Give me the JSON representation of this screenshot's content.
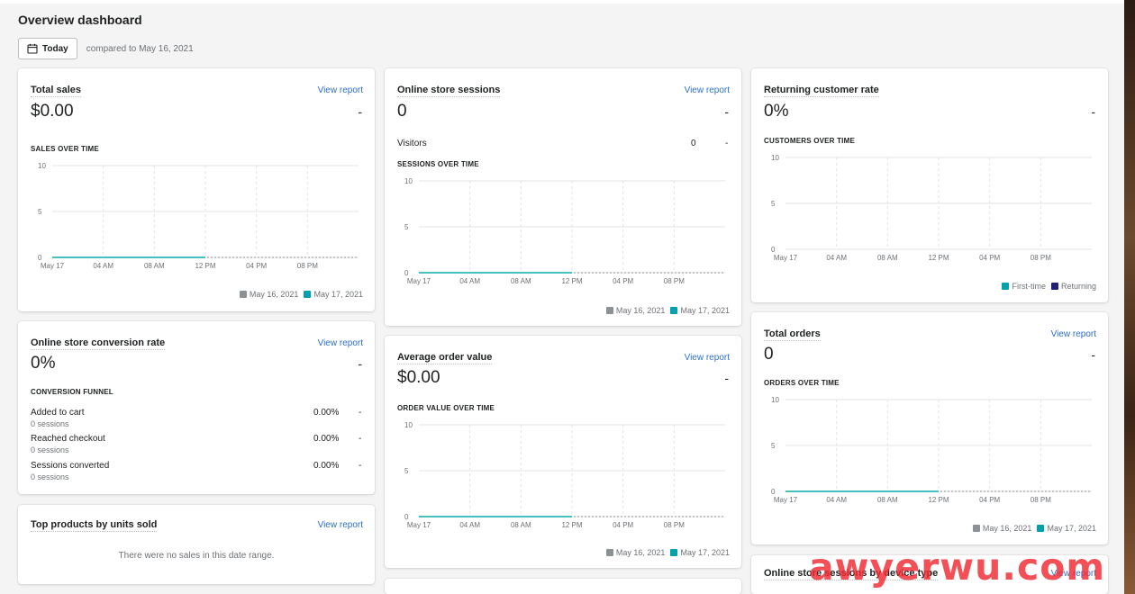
{
  "page": {
    "title": "Overview dashboard",
    "today_label": "Today",
    "compared_text": "compared to May 16, 2021"
  },
  "colors": {
    "accent": "#2c6ecb",
    "series_current": "#47c1bf",
    "series_previous": "#8c9196",
    "legend_teal": "#00a0ac",
    "legend_navy": "#1f1f7a"
  },
  "common": {
    "view_report": "View report",
    "dash": "-"
  },
  "cards": {
    "total_sales": {
      "title": "Total sales",
      "value": "$0.00",
      "section": "SALES OVER TIME",
      "legend": [
        "May 16, 2021",
        "May 17, 2021"
      ]
    },
    "sessions": {
      "title": "Online store sessions",
      "value": "0",
      "visitors_label": "Visitors",
      "visitors_value": "0",
      "section": "SESSIONS OVER TIME",
      "legend": [
        "May 16, 2021",
        "May 17, 2021"
      ]
    },
    "returning": {
      "title": "Returning customer rate",
      "value": "0%",
      "section": "CUSTOMERS OVER TIME",
      "legend": [
        "First-time",
        "Returning"
      ]
    },
    "conversion": {
      "title": "Online store conversion rate",
      "value": "0%",
      "section": "CONVERSION FUNNEL",
      "rows": [
        {
          "label": "Added to cart",
          "sub": "0 sessions",
          "pct": "0.00%"
        },
        {
          "label": "Reached checkout",
          "sub": "0 sessions",
          "pct": "0.00%"
        },
        {
          "label": "Sessions converted",
          "sub": "0 sessions",
          "pct": "0.00%"
        }
      ]
    },
    "aov": {
      "title": "Average order value",
      "value": "$0.00",
      "section": "ORDER VALUE OVER TIME",
      "legend": [
        "May 16, 2021",
        "May 17, 2021"
      ]
    },
    "orders": {
      "title": "Total orders",
      "value": "0",
      "section": "ORDERS OVER TIME",
      "legend": [
        "May 16, 2021",
        "May 17, 2021"
      ]
    },
    "top_products": {
      "title": "Top products by units sold",
      "empty": "There were no sales in this date range."
    },
    "device": {
      "title": "Online store sessions by device type"
    }
  },
  "watermark": "awyerwu.com",
  "chart_data": [
    {
      "type": "line",
      "name": "sales-over-time",
      "x": [
        "May 17",
        "04 AM",
        "08 AM",
        "12 PM",
        "04 PM",
        "08 PM"
      ],
      "ylim": [
        0,
        10
      ],
      "yticks": [
        0,
        5,
        10
      ],
      "series": [
        {
          "name": "May 16, 2021",
          "values": [
            0,
            0,
            0,
            0,
            0,
            0,
            0
          ]
        },
        {
          "name": "May 17, 2021",
          "values": [
            0,
            0,
            0,
            0
          ]
        }
      ]
    },
    {
      "type": "line",
      "name": "sessions-over-time",
      "x": [
        "May 17",
        "04 AM",
        "08 AM",
        "12 PM",
        "04 PM",
        "08 PM"
      ],
      "ylim": [
        0,
        10
      ],
      "yticks": [
        0,
        5,
        10
      ],
      "series": [
        {
          "name": "May 16, 2021",
          "values": [
            0,
            0,
            0,
            0,
            0,
            0,
            0
          ]
        },
        {
          "name": "May 17, 2021",
          "values": [
            0,
            0,
            0,
            0
          ]
        }
      ]
    },
    {
      "type": "line",
      "name": "customers-over-time",
      "x": [
        "May 17",
        "04 AM",
        "08 AM",
        "12 PM",
        "04 PM",
        "08 PM"
      ],
      "ylim": [
        0,
        10
      ],
      "yticks": [
        0,
        5,
        10
      ],
      "series": [
        {
          "name": "First-time",
          "values": []
        },
        {
          "name": "Returning",
          "values": []
        }
      ]
    },
    {
      "type": "line",
      "name": "order-value-over-time",
      "x": [
        "May 17",
        "04 AM",
        "08 AM",
        "12 PM",
        "04 PM",
        "08 PM"
      ],
      "ylim": [
        0,
        10
      ],
      "yticks": [
        0,
        5,
        10
      ],
      "series": [
        {
          "name": "May 16, 2021",
          "values": [
            0,
            0,
            0,
            0,
            0,
            0,
            0
          ]
        },
        {
          "name": "May 17, 2021",
          "values": [
            0,
            0,
            0,
            0
          ]
        }
      ]
    },
    {
      "type": "line",
      "name": "orders-over-time",
      "x": [
        "May 17",
        "04 AM",
        "08 AM",
        "12 PM",
        "04 PM",
        "08 PM"
      ],
      "ylim": [
        0,
        10
      ],
      "yticks": [
        0,
        5,
        10
      ],
      "series": [
        {
          "name": "May 16, 2021",
          "values": [
            0,
            0,
            0,
            0,
            0,
            0,
            0
          ]
        },
        {
          "name": "May 17, 2021",
          "values": [
            0,
            0,
            0,
            0
          ]
        }
      ]
    }
  ]
}
